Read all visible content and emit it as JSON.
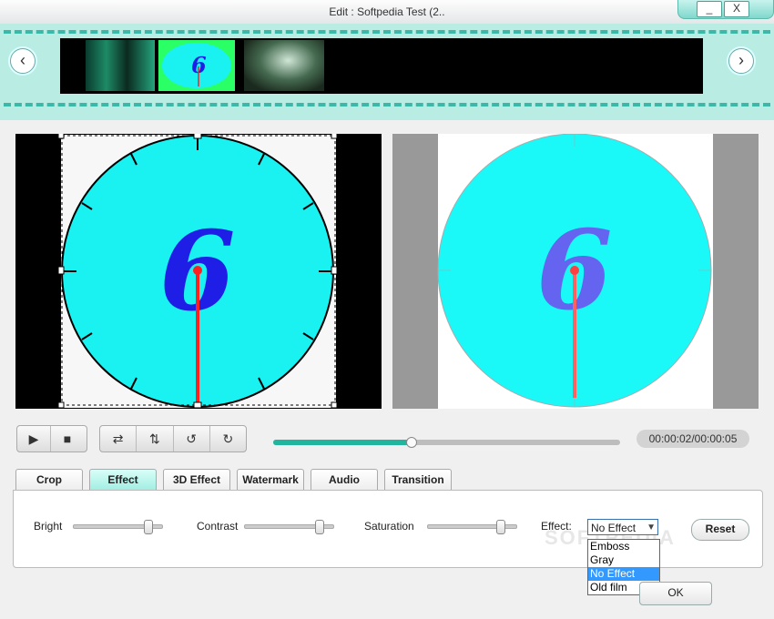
{
  "window": {
    "title": "Edit : Softpedia Test (2..",
    "minimize_label": "_",
    "close_label": "X"
  },
  "filmstrip": {
    "prev_label": "‹",
    "next_label": "›",
    "active_thumb_numeral": "6"
  },
  "preview": {
    "numeral": "6"
  },
  "player": {
    "play_label": "▶",
    "stop_label": "■",
    "flip_h_label": "⇄",
    "flip_v_label": "⇅",
    "rotate_ccw_label": "↺",
    "rotate_cw_label": "↻",
    "progress": 0.4,
    "timecode": "00:00:02/00:00:05"
  },
  "tabs": [
    {
      "label": "Crop",
      "active": false
    },
    {
      "label": "Effect",
      "active": true
    },
    {
      "label": "3D Effect",
      "active": false
    },
    {
      "label": "Watermark",
      "active": false
    },
    {
      "label": "Audio",
      "active": false
    },
    {
      "label": "Transition",
      "active": false
    }
  ],
  "effect_panel": {
    "bright_label": "Bright",
    "bright_value": 0.85,
    "contrast_label": "Contrast",
    "contrast_value": 0.85,
    "saturation_label": "Saturation",
    "saturation_value": 0.82,
    "effect_label": "Effect:",
    "effect_selected": "No Effect",
    "effect_options": [
      "Emboss",
      "Gray",
      "No Effect",
      "Old film"
    ],
    "reset_label": "Reset"
  },
  "ok_label": "OK",
  "watermark_text": "SOFTPEDIA",
  "colors": {
    "accent": "#21b59e",
    "clock_face": "#1af2f2",
    "numeral": "#1e1ee6",
    "hand": "#ff2020"
  }
}
